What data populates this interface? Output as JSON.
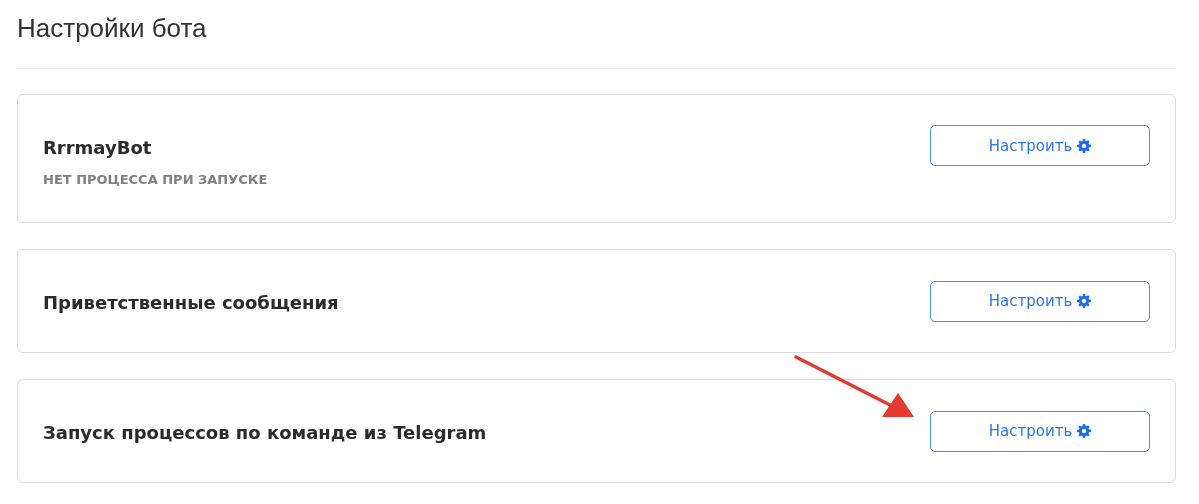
{
  "page_title": "Настройки бота",
  "cards": [
    {
      "title": "RrrmayBot",
      "subtitle": "НЕТ ПРОЦЕССА ПРИ ЗАПУСКЕ",
      "button": "Настроить"
    },
    {
      "title": "Приветственные сообщения",
      "button": "Настроить"
    },
    {
      "title": "Запуск процессов по команде из Telegram",
      "button": "Настроить"
    }
  ]
}
